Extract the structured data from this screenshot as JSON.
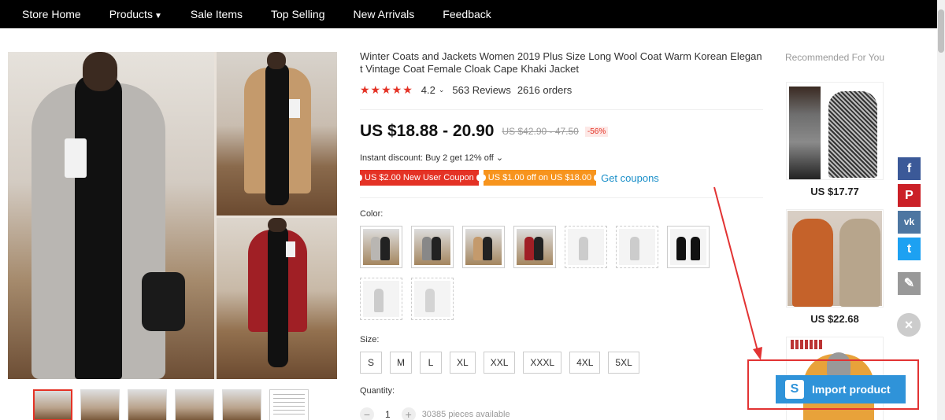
{
  "nav": {
    "items": [
      "Store Home",
      "Products",
      "Sale Items",
      "Top Selling",
      "New Arrivals",
      "Feedback"
    ]
  },
  "product": {
    "title": "Winter Coats and Jackets Women 2019 Plus Size Long Wool Coat Warm Korean Elegant Vintage Coat Female Cloak Cape Khaki Jacket",
    "stars": "★★★★★",
    "rating": "4.2",
    "rating_value": 4.2,
    "reviews": "563 Reviews",
    "orders": "2616 orders",
    "price": "US $18.88 - 20.90",
    "old_price": "US $42.90 - 47.50",
    "discount": "-56%",
    "instant_discount": "Instant discount: Buy 2 get 12% off",
    "coupons": [
      "US $2.00 New User Coupon",
      "US $1.00 off on US $18.00"
    ],
    "get_coupons": "Get coupons",
    "color_label": "Color:",
    "size_label": "Size:",
    "sizes": [
      "S",
      "M",
      "L",
      "XL",
      "XXL",
      "XXXL",
      "4XL",
      "5XL"
    ],
    "quantity_label": "Quantity:",
    "quantity": "1",
    "qty_minus": "−",
    "qty_plus": "+",
    "available": "30385 pieces available"
  },
  "recommended": {
    "title": "Recommended For You",
    "prices": [
      "US $17.77",
      "US $22.68"
    ]
  },
  "share": {
    "facebook": "f",
    "pinterest": "P",
    "vk": "vk",
    "twitter": "t",
    "edit": "✎",
    "close": "×"
  },
  "plugin": {
    "icon_letter": "S",
    "import_label": "Import product"
  },
  "colors": {
    "accent": "#e43225",
    "coupon_orange": "#f7941d",
    "link": "#1a8fc9",
    "import_blue": "#2f93d9",
    "highlight_red": "#e23333"
  }
}
